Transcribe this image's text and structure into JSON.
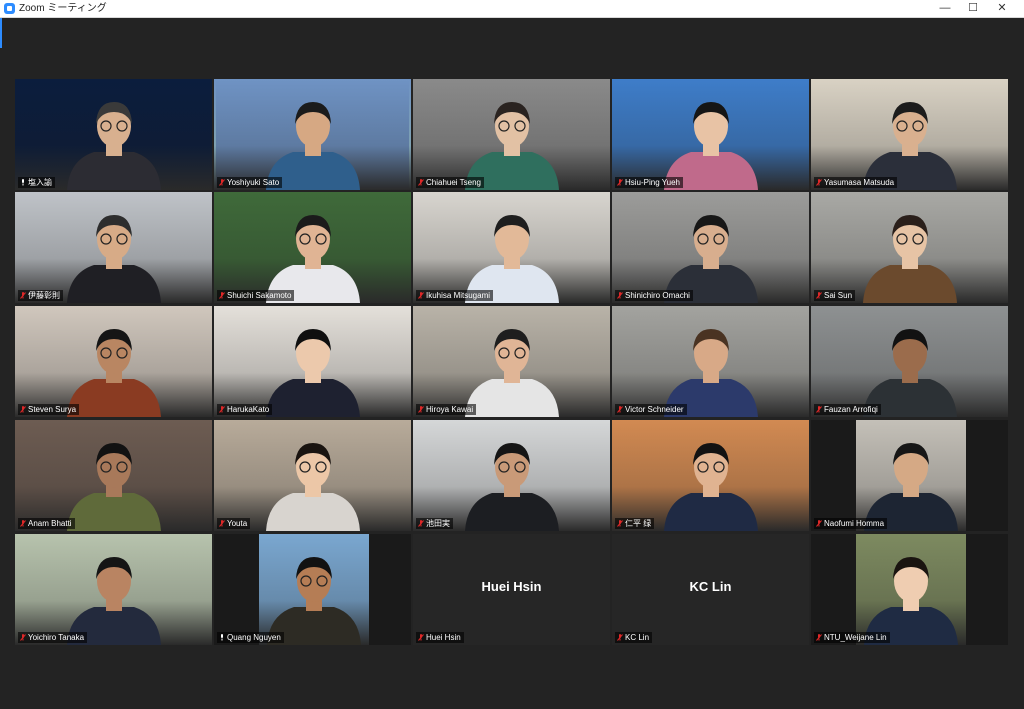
{
  "window": {
    "title": "Zoom ミーティング",
    "controls": {
      "minimize": "—",
      "maximize": "☐",
      "close": "✕"
    }
  },
  "tiles": [
    {
      "name": "塩入諭",
      "bg": "#0b1d3d",
      "skin": "#d8b08f",
      "shirt": "#2c2c33",
      "hair": "#3a3a3a",
      "glasses": true,
      "audio_muted": false
    },
    {
      "name": "Yoshiyuki Sato",
      "bg": "#6f93c4",
      "skin": "#d6a883",
      "shirt": "#2f5f8c",
      "hair": "#1b1b1b",
      "glasses": false,
      "audio_muted": true,
      "active_speaker": true
    },
    {
      "name": "Chiahuei Tseng",
      "bg": "#8a8a8a",
      "skin": "#e2c1a4",
      "shirt": "#2f6f5e",
      "hair": "#2a2320",
      "glasses": true,
      "audio_muted": true
    },
    {
      "name": "Hsiu-Ping Yueh",
      "bg": "#3e7dc9",
      "skin": "#e8c3a5",
      "shirt": "#c06a8b",
      "hair": "#151515",
      "glasses": false,
      "audio_muted": true
    },
    {
      "name": "Yasumasa Matsuda",
      "bg": "#d9d2c4",
      "skin": "#d9b08f",
      "shirt": "#2b2f3a",
      "hair": "#1c1c1c",
      "glasses": true,
      "audio_muted": true
    },
    {
      "name": "伊藤彰則",
      "bg": "#bfc3c8",
      "skin": "#d7ab87",
      "shirt": "#1f1f24",
      "hair": "#2d2d2d",
      "glasses": true,
      "audio_muted": true
    },
    {
      "name": "Shuichi Sakamoto",
      "bg": "#3f6a3a",
      "skin": "#e0b494",
      "shirt": "#e8e8ec",
      "hair": "#1b1b1b",
      "glasses": true,
      "audio_muted": true
    },
    {
      "name": "Ikuhisa Mitsugami",
      "bg": "#d8d5cf",
      "skin": "#e2b998",
      "shirt": "#dfe6f0",
      "hair": "#1e1e1e",
      "glasses": false,
      "audio_muted": true
    },
    {
      "name": "Shinichiro Omachi",
      "bg": "#9c9c9a",
      "skin": "#d8ae8e",
      "shirt": "#2b2f38",
      "hair": "#171717",
      "glasses": true,
      "audio_muted": true
    },
    {
      "name": "Sai Sun",
      "bg": "#a9a9a5",
      "skin": "#e7c4a5",
      "shirt": "#6b4a2d",
      "hair": "#2a1f1a",
      "glasses": true,
      "audio_muted": true
    },
    {
      "name": "Steven Surya",
      "bg": "#d0c7bd",
      "skin": "#b98662",
      "shirt": "#8a3b22",
      "hair": "#151515",
      "glasses": true,
      "audio_muted": true
    },
    {
      "name": "HarukaKato",
      "bg": "#e4e0da",
      "skin": "#ecc9ac",
      "shirt": "#1e2130",
      "hair": "#0f0f0f",
      "glasses": false,
      "audio_muted": true
    },
    {
      "name": "Hiroya Kawai",
      "bg": "#b9b3a8",
      "skin": "#e0b596",
      "shirt": "#e5e5e5",
      "hair": "#1e1e1e",
      "glasses": true,
      "audio_muted": true
    },
    {
      "name": "Victor Schneider",
      "bg": "#a3a39f",
      "skin": "#d8a987",
      "shirt": "#2c3a6b",
      "hair": "#4a3322",
      "glasses": false,
      "audio_muted": true
    },
    {
      "name": "Fauzan Arrofiqi",
      "bg": "#8e9192",
      "skin": "#9b6c4c",
      "shirt": "#2c3135",
      "hair": "#121212",
      "glasses": false,
      "audio_muted": true
    },
    {
      "name": "Anam Bhatti",
      "bg": "#6d5c52",
      "skin": "#a8795a",
      "shirt": "#5f6a3a",
      "hair": "#121212",
      "glasses": true,
      "audio_muted": true
    },
    {
      "name": "Youta",
      "bg": "#b8ab9a",
      "skin": "#ecc7a7",
      "shirt": "#d8d4cf",
      "hair": "#1a1410",
      "glasses": true,
      "audio_muted": true
    },
    {
      "name": "池田実",
      "bg": "#d5d7d8",
      "skin": "#c99a78",
      "shirt": "#1c1e22",
      "hair": "#151515",
      "glasses": true,
      "audio_muted": true
    },
    {
      "name": "仁平 绿",
      "bg": "#d28a52",
      "skin": "#e0b391",
      "shirt": "#1f2a44",
      "hair": "#121212",
      "glasses": true,
      "audio_muted": true
    },
    {
      "name": "Naofumi Homma",
      "bg": "#c4c0b8",
      "skin": "#d5a985",
      "shirt": "#1d2533",
      "hair": "#161616",
      "glasses": false,
      "audio_muted": true,
      "video_narrow": true
    },
    {
      "name": "Yoichiro Tanaka",
      "bg": "#b7c3ad",
      "skin": "#b98462",
      "shirt": "#232a3d",
      "hair": "#151515",
      "glasses": false,
      "audio_muted": true
    },
    {
      "name": "Quang Nguyen",
      "bg": "#7aa7d0",
      "skin": "#b57d55",
      "shirt": "#2d2b24",
      "hair": "#121212",
      "glasses": true,
      "audio_muted": false,
      "video_narrow": true
    },
    {
      "name": "Huei Hsin",
      "video_off": true,
      "audio_muted": true
    },
    {
      "name": "KC Lin",
      "video_off": true,
      "audio_muted": true
    },
    {
      "name": "NTU_Weijane Lin",
      "bg": "#7d8a60",
      "skin": "#efcdb1",
      "shirt": "#1f2b43",
      "hair": "#1a1410",
      "glasses": false,
      "audio_muted": true,
      "video_narrow": true
    }
  ]
}
